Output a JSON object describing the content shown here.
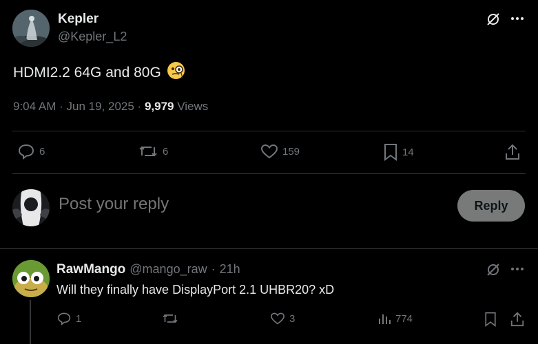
{
  "tweet": {
    "author_name": "Kepler",
    "author_handle": "@Kepler_L2",
    "text": "HDMI2.2 64G and 80G",
    "emoji": "🧐",
    "time": "9:04 AM",
    "date": "Jun 19, 2025",
    "views_count": "9,979",
    "views_label": "Views",
    "replies": "6",
    "reposts": "6",
    "likes": "159",
    "bookmarks": "14"
  },
  "reply_box": {
    "placeholder": "Post your reply",
    "button_label": "Reply"
  },
  "reply": {
    "author_name": "RawMango",
    "author_handle": "@mango_raw",
    "time": "21h",
    "text": "Will they finally have DisplayPort 2.1 UHBR20? xD",
    "replies": "1",
    "reposts": "",
    "likes": "3",
    "views": "774"
  },
  "icons": {
    "grok": "grok-icon",
    "more": "more-icon",
    "reply": "reply-icon",
    "repost": "repost-icon",
    "like": "like-icon",
    "bookmark": "bookmark-icon",
    "share": "share-icon",
    "views": "views-icon"
  },
  "colors": {
    "background": "#000000",
    "text": "#e7e9ea",
    "muted": "#71767b",
    "divider": "#2f3336",
    "reply_button_bg": "#787a7a"
  }
}
